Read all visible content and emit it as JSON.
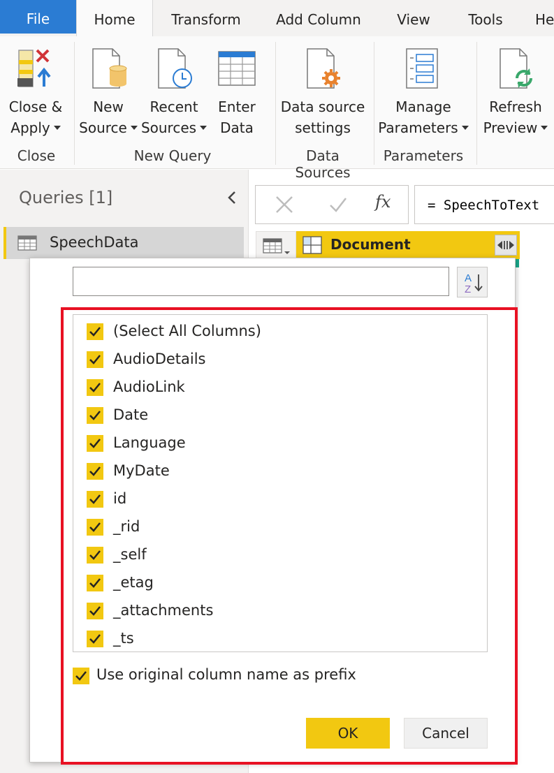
{
  "tabs": [
    {
      "label": "File"
    },
    {
      "label": "Home"
    },
    {
      "label": "Transform"
    },
    {
      "label": "Add Column"
    },
    {
      "label": "View"
    },
    {
      "label": "Tools"
    },
    {
      "label": "Help"
    }
  ],
  "ribbon": {
    "close_apply": {
      "line1": "Close &",
      "line2": "Apply"
    },
    "new_source": {
      "line1": "New",
      "line2": "Source"
    },
    "recent_sources": {
      "line1": "Recent",
      "line2": "Sources"
    },
    "enter_data": {
      "line1": "Enter",
      "line2": "Data"
    },
    "data_source_settings": {
      "line1": "Data source",
      "line2": "settings"
    },
    "manage_parameters": {
      "line1": "Manage",
      "line2": "Parameters"
    },
    "refresh_preview": {
      "line1": "Refresh",
      "line2": "Preview"
    },
    "groups": {
      "close": "Close",
      "new_query": "New Query",
      "data_sources": "Data Sources",
      "parameters": "Parameters"
    }
  },
  "queries": {
    "title": "Queries [1]",
    "items": [
      {
        "label": "SpeechData"
      }
    ]
  },
  "formula_bar": {
    "fx": "fx",
    "formula": "= SpeechToText"
  },
  "grid": {
    "column_header": "Document"
  },
  "expand_popup": {
    "search_value": "",
    "columns": [
      {
        "label": "(Select All Columns)",
        "checked": true
      },
      {
        "label": "AudioDetails",
        "checked": true
      },
      {
        "label": "AudioLink",
        "checked": true
      },
      {
        "label": "Date",
        "checked": true
      },
      {
        "label": "Language",
        "checked": true
      },
      {
        "label": "MyDate",
        "checked": true
      },
      {
        "label": "id",
        "checked": true
      },
      {
        "label": "_rid",
        "checked": true
      },
      {
        "label": "_self",
        "checked": true
      },
      {
        "label": "_etag",
        "checked": true
      },
      {
        "label": "_attachments",
        "checked": true
      },
      {
        "label": "_ts",
        "checked": true
      }
    ],
    "use_prefix_label": "Use original column name as prefix",
    "use_prefix_checked": true,
    "ok_label": "OK",
    "cancel_label": "Cancel"
  },
  "colors": {
    "accent_yellow": "#f2c811",
    "file_tab_blue": "#2b7cd3",
    "highlight_red": "#e81123"
  }
}
